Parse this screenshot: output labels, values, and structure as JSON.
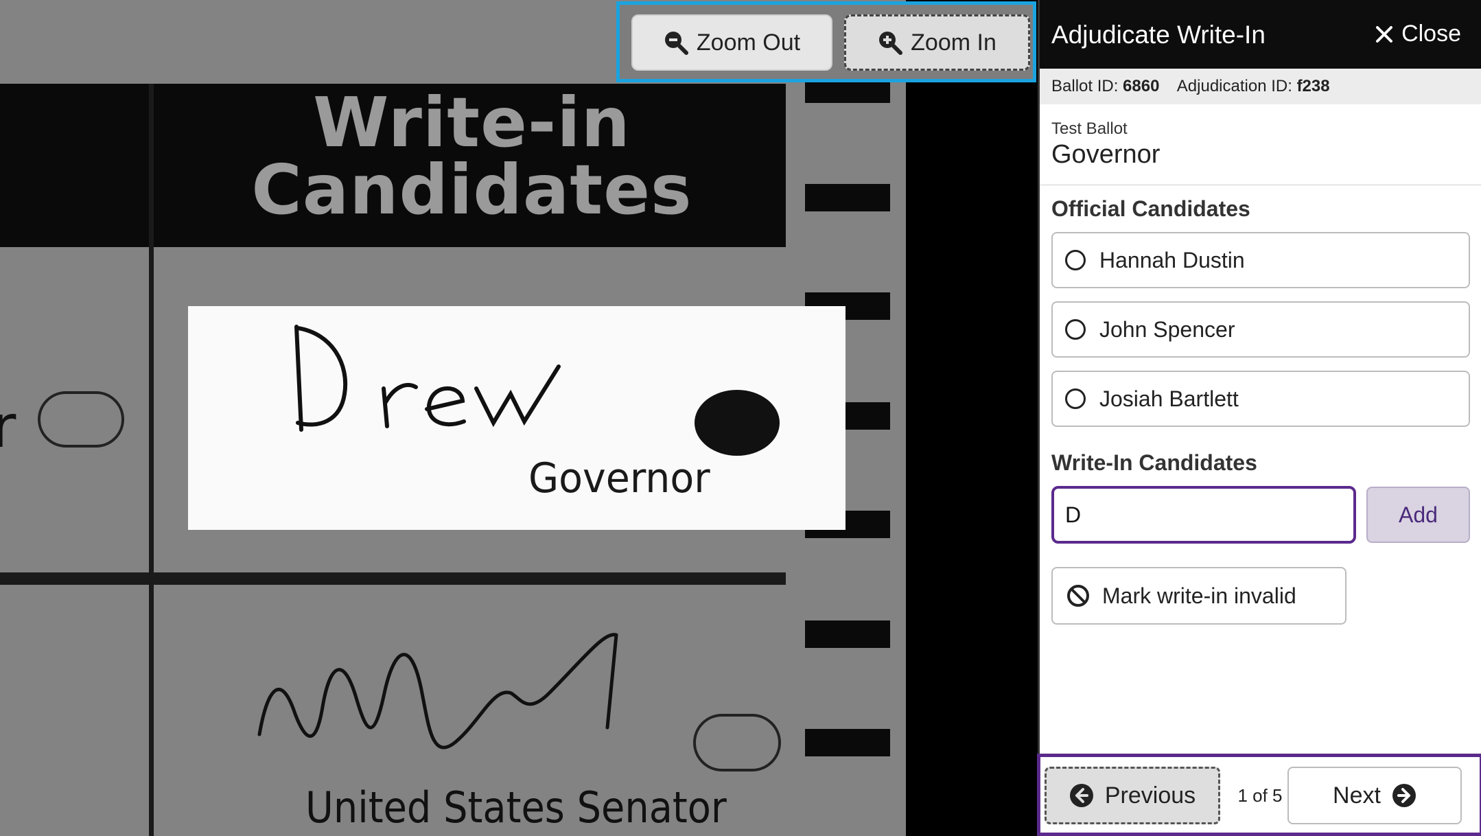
{
  "ballot_image": {
    "header": [
      "Write-in",
      "Candidates"
    ],
    "handwriting": "Drew",
    "contest_label": "Governor",
    "next_contest_label": "United States Senator"
  },
  "zoom": {
    "zoom_out_label": "Zoom Out",
    "zoom_in_label": "Zoom In"
  },
  "panel": {
    "title": "Adjudicate Write-In",
    "close_label": "Close",
    "ballot_id_label": "Ballot ID:",
    "ballot_id": "6860",
    "adjudication_id_label": "Adjudication ID:",
    "adjudication_id": "f238",
    "ballot_style": "Test Ballot",
    "contest": "Governor",
    "official_title": "Official Candidates",
    "candidates": [
      {
        "name": "Hannah Dustin"
      },
      {
        "name": "John Spencer"
      },
      {
        "name": "Josiah Bartlett"
      }
    ],
    "writein_title": "Write-In Candidates",
    "writein_value": "D",
    "add_label": "Add",
    "invalid_label": "Mark write-in invalid",
    "prev_label": "Previous",
    "next_label": "Next",
    "page_status": "1 of 5"
  },
  "colors": {
    "accent_purple": "#5b2a8c",
    "focus_blue": "#1ba3e0",
    "header_black": "#0d0d0d"
  }
}
